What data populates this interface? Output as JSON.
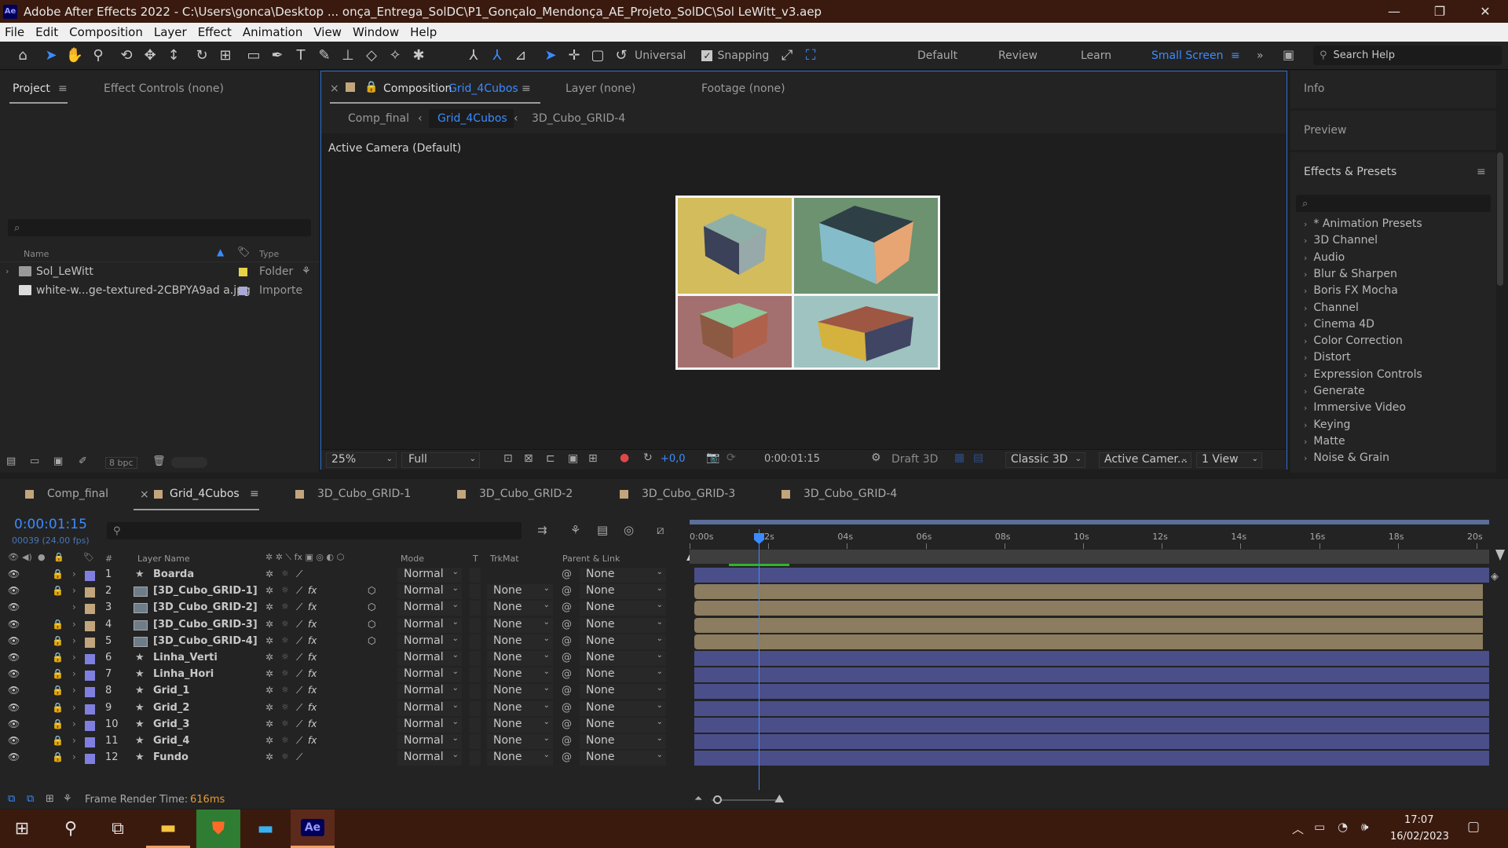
{
  "window": {
    "title": "Adobe After Effects 2022 - C:\\Users\\gonca\\Desktop ... onça_Entrega_SolDC\\P1_Gonçalo_Mendonça_AE_Projeto_SolDC\\Sol LeWitt_v3.aep",
    "app_icon": "Ae",
    "minimize": "—",
    "restore": "❐",
    "close": "✕"
  },
  "menu": [
    "File",
    "Edit",
    "Composition",
    "Layer",
    "Effect",
    "Animation",
    "View",
    "Window",
    "Help"
  ],
  "toolbar": {
    "axis_mode": "Universal",
    "snapping_label": "Snapping",
    "workspaces": [
      "Default",
      "Review",
      "Learn",
      "Small Screen"
    ],
    "active_workspace": "Small Screen",
    "search_help": "Search Help"
  },
  "project_panel": {
    "tab_project": "Project",
    "tab_effect_controls": "Effect Controls (none)",
    "search_placeholder": "⌕",
    "col_name": "Name",
    "col_type": "Type",
    "items": [
      {
        "name": "Sol_LeWitt",
        "type": "Folder",
        "label_color": "#e8d24a"
      },
      {
        "name": "white-w...ge-textured-2CBPYA9ad a.jpg",
        "type": "Importe",
        "label_color": "#a9a9d8"
      }
    ],
    "bpc": "8 bpc"
  },
  "comp_panel": {
    "tab_comp_prefix": "Composition",
    "tab_comp_name": "Grid_4Cubos",
    "tab_layer": "Layer  (none)",
    "tab_footage": "Footage  (none)",
    "breadcrumbs": [
      "Comp_final",
      "Grid_4Cubos",
      "3D_Cubo_GRID-4"
    ],
    "camera_label": "Active Camera (Default)",
    "zoom": "25%",
    "resolution": "Full",
    "exposure": "+0,0",
    "timecode": "0:00:01:15",
    "draft3d": "Draft 3D",
    "renderer": "Classic 3D",
    "camera_select": "Active Camer...",
    "views": "1 View",
    "quadrants": [
      {
        "bg": "#d3bc5c",
        "top": "#8fb0a8",
        "left": "#3a4158",
        "right": "#97a9a8"
      },
      {
        "bg": "#6c9270",
        "top": "#2e3f46",
        "left": "#85bcc9",
        "right": "#e8a574"
      },
      {
        "bg": "#a3706f",
        "top": "#8ec79a",
        "left": "#8c5a42",
        "right": "#b0614b"
      },
      {
        "bg": "#9fc3c0",
        "top": "#9e5742",
        "left": "#d5b13e",
        "right": "#404563"
      }
    ]
  },
  "right_panel": {
    "info": "Info",
    "preview": "Preview",
    "effects_presets": "Effects & Presets",
    "search_placeholder": "⌕",
    "items": [
      "* Animation Presets",
      "3D Channel",
      "Audio",
      "Blur & Sharpen",
      "Boris FX Mocha",
      "Channel",
      "Cinema 4D",
      "Color Correction",
      "Distort",
      "Expression Controls",
      "Generate",
      "Immersive Video",
      "Keying",
      "Matte",
      "Noise & Grain"
    ]
  },
  "timeline": {
    "tabs": [
      {
        "name": "Comp_final",
        "color": "#c2a57c"
      },
      {
        "name": "Grid_4Cubos",
        "color": "#c2a57c",
        "active": true
      },
      {
        "name": "3D_Cubo_GRID-1",
        "color": "#c2a57c"
      },
      {
        "name": "3D_Cubo_GRID-2",
        "color": "#c2a57c"
      },
      {
        "name": "3D_Cubo_GRID-3",
        "color": "#c2a57c"
      },
      {
        "name": "3D_Cubo_GRID-4",
        "color": "#c2a57c"
      }
    ],
    "current_time": "0:00:01:15",
    "frame_info": "00039 (24.00 fps)",
    "ruler": [
      "0:00s",
      "02s",
      "04s",
      "06s",
      "08s",
      "10s",
      "12s",
      "14s",
      "16s",
      "18s",
      "20s"
    ],
    "col_hash": "#",
    "col_layer_name": "Layer Name",
    "col_mode": "Mode",
    "col_t": "T",
    "col_trkmat": "TrkMat",
    "col_parent": "Parent & Link",
    "layers": [
      {
        "num": "1",
        "name": "Boarda",
        "type": "star",
        "color": "#7f7fe0",
        "mode": "Normal",
        "trkmat": "",
        "parent": "None",
        "lock": true,
        "fx": false,
        "bar": "#4a4f8a"
      },
      {
        "num": "2",
        "name": "[3D_Cubo_GRID-1]",
        "type": "comp",
        "color": "#c2a57c",
        "mode": "Normal",
        "trkmat": "None",
        "parent": "None",
        "lock": true,
        "fx": true,
        "bar": "#8c7c60"
      },
      {
        "num": "3",
        "name": "[3D_Cubo_GRID-2]",
        "type": "comp",
        "color": "#c2a57c",
        "mode": "Normal",
        "trkmat": "None",
        "parent": "None",
        "lock": false,
        "fx": true,
        "bar": "#8c7c60"
      },
      {
        "num": "4",
        "name": "[3D_Cubo_GRID-3]",
        "type": "comp",
        "color": "#c2a57c",
        "mode": "Normal",
        "trkmat": "None",
        "parent": "None",
        "lock": true,
        "fx": true,
        "bar": "#8c7c60"
      },
      {
        "num": "5",
        "name": "[3D_Cubo_GRID-4]",
        "type": "comp",
        "color": "#c2a57c",
        "mode": "Normal",
        "trkmat": "None",
        "parent": "None",
        "lock": true,
        "fx": true,
        "bar": "#8c7c60"
      },
      {
        "num": "6",
        "name": "Linha_Verti",
        "type": "star",
        "color": "#7f7fe0",
        "mode": "Normal",
        "trkmat": "None",
        "parent": "None",
        "lock": true,
        "fx": true,
        "bar": "#4a4f8a"
      },
      {
        "num": "7",
        "name": "Linha_Hori",
        "type": "star",
        "color": "#7f7fe0",
        "mode": "Normal",
        "trkmat": "None",
        "parent": "None",
        "lock": true,
        "fx": true,
        "bar": "#4a4f8a"
      },
      {
        "num": "8",
        "name": "Grid_1",
        "type": "star",
        "color": "#7f7fe0",
        "mode": "Normal",
        "trkmat": "None",
        "parent": "None",
        "lock": true,
        "fx": true,
        "bar": "#4a4f8a"
      },
      {
        "num": "9",
        "name": "Grid_2",
        "type": "star",
        "color": "#7f7fe0",
        "mode": "Normal",
        "trkmat": "None",
        "parent": "None",
        "lock": true,
        "fx": true,
        "bar": "#4a4f8a"
      },
      {
        "num": "10",
        "name": "Grid_3",
        "type": "star",
        "color": "#7f7fe0",
        "mode": "Normal",
        "trkmat": "None",
        "parent": "None",
        "lock": true,
        "fx": true,
        "bar": "#4a4f8a"
      },
      {
        "num": "11",
        "name": "Grid_4",
        "type": "star",
        "color": "#7f7fe0",
        "mode": "Normal",
        "trkmat": "None",
        "parent": "None",
        "lock": true,
        "fx": true,
        "bar": "#4a4f8a"
      },
      {
        "num": "12",
        "name": "Fundo",
        "type": "star",
        "color": "#7f7fe0",
        "mode": "Normal",
        "trkmat": "None",
        "parent": "None",
        "lock": true,
        "fx": false,
        "bar": "#4a4f8a"
      }
    ],
    "frame_render_label": "Frame Render Time:",
    "frame_render_value": "616ms"
  },
  "taskbar": {
    "time": "17:07",
    "date": "16/02/2023"
  }
}
